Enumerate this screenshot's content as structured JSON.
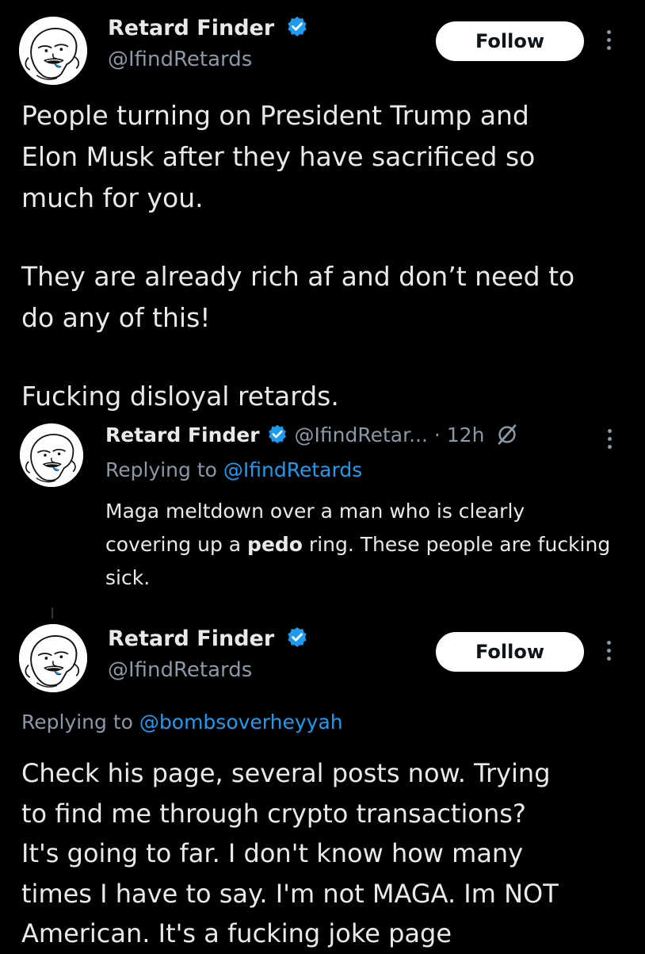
{
  "colors": {
    "background": "#000000",
    "text": "#e7e9ea",
    "muted": "#8b98a5",
    "link": "#1d9bf0",
    "verified": "#1d9bf0",
    "follow_bg": "#ffffff",
    "follow_text": "#0f1419"
  },
  "post1": {
    "author_name": "Retard Finder",
    "author_handle": "@IfindRetards",
    "follow_label": "Follow",
    "paragraphs": [
      "People turning on President Trump and\nElon Musk after they have sacrificed so\nmuch for you.",
      "They are already rich af and don’t need to\ndo any of this!",
      "Fucking disloyal retards."
    ]
  },
  "quoted": {
    "author_name": "Retard Finder",
    "author_handle": "@IfindRetar...",
    "time": "· 12h",
    "replying_prefix": "Replying to",
    "replying_to": "@IfindRetards",
    "text_part1": "Maga meltdown over a man who is clearly covering up a",
    "text_bold": "pedo",
    "text_part2": "ring. These people are fucking sick.",
    "icons": [
      "verified-badge-icon",
      "grok-slash-icon",
      "more-options-icon"
    ]
  },
  "post2": {
    "author_name": "Retard Finder",
    "author_handle": "@IfindRetards",
    "follow_label": "Follow",
    "replying_prefix": "Replying to",
    "replying_to": "@bombsoverheyyah",
    "text": "Check his page, several posts now. Trying\nto find me through crypto transactions?\nIt's going to far. I don't know how many\ntimes I have to say. I'm not MAGA. Im NOT\nAmerican. It's a fucking joke page"
  }
}
